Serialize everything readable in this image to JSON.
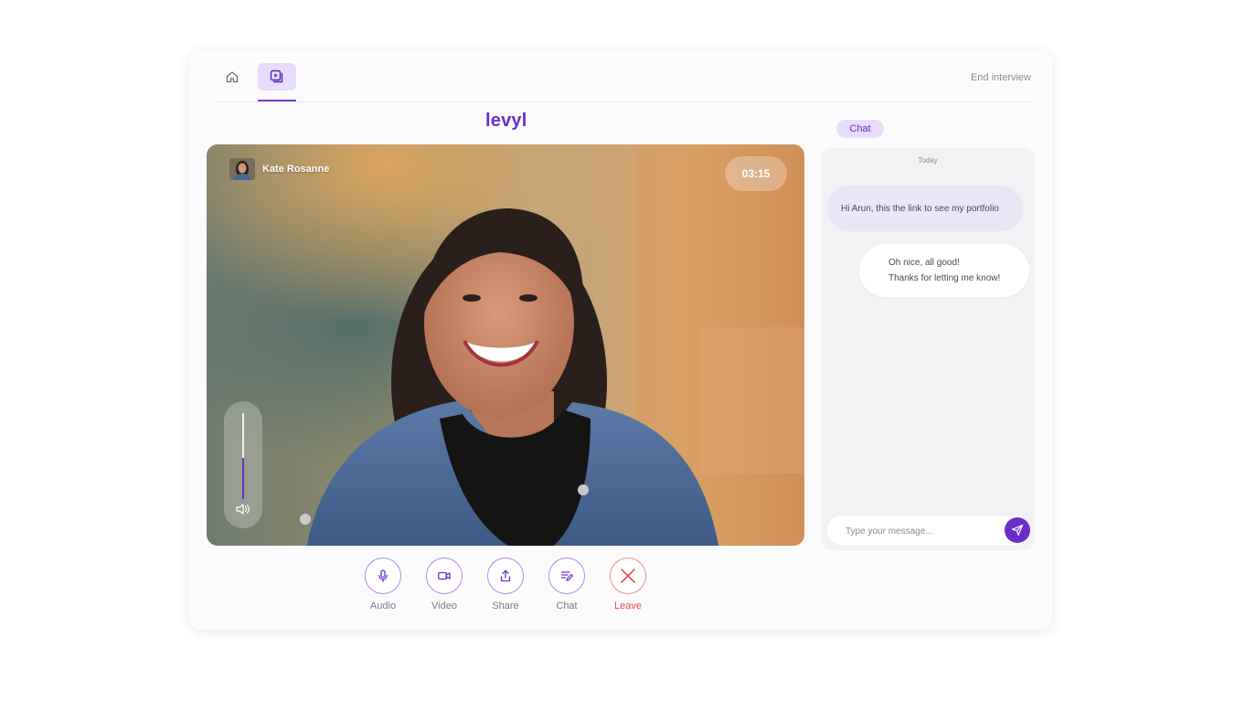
{
  "header": {
    "end_interview": "End interview",
    "active_nav": "video"
  },
  "brand": {
    "logo": "levyl"
  },
  "call": {
    "participant_name": "Kate Rosanne",
    "timer": "03:15",
    "volume_level": 0.48
  },
  "controls": [
    {
      "id": "audio",
      "label": "Audio",
      "icon": "microphone-icon"
    },
    {
      "id": "video",
      "label": "Video",
      "icon": "video-camera-icon"
    },
    {
      "id": "share",
      "label": "Share",
      "icon": "share-upload-icon"
    },
    {
      "id": "chat",
      "label": "Chat",
      "icon": "chat-edit-icon"
    },
    {
      "id": "leave",
      "label": "Leave",
      "icon": "close-icon"
    }
  ],
  "chat": {
    "tab_label": "Chat",
    "date_label": "Today",
    "messages": [
      {
        "direction": "incoming",
        "lines": [
          "Hi Arun, this the link to see my portfolio"
        ]
      },
      {
        "direction": "outgoing",
        "lines": [
          "Oh nice, all good!",
          "Thanks for letting me know!"
        ]
      }
    ],
    "input_placeholder": "Type your message..."
  },
  "colors": {
    "accent": "#6a2fc9",
    "accent_light": "#e7dcfb",
    "leave_red": "#e24a57"
  }
}
